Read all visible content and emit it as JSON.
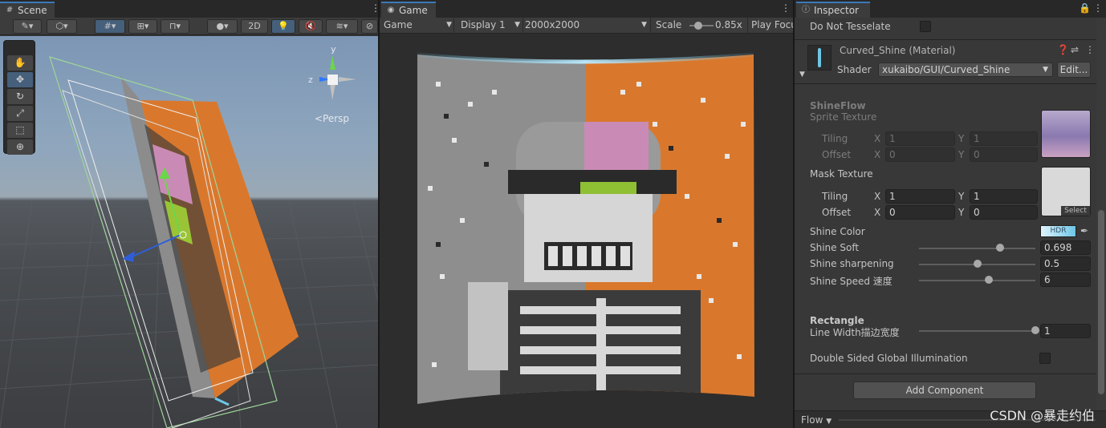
{
  "scene": {
    "tab": "Scene",
    "toolbar": {
      "mode_2d": "2D"
    },
    "persp_label": "<Persp",
    "gizmo": {
      "y": "y",
      "z": "z"
    }
  },
  "game": {
    "tab": "Game",
    "display_mode": "Game",
    "display": "Display 1",
    "resolution": "2000x2000",
    "scale_label": "Scale",
    "scale_value": "0.85x",
    "play_focus": "Play Focu",
    "scale_fraction": 0.3
  },
  "inspector": {
    "tab": "Inspector",
    "do_not_tesselate_label": "Do Not Tesselate",
    "material_name": "Curved_Shine (Material)",
    "shader_label": "Shader",
    "shader_value": "xukaibo/GUI/Curved_Shine",
    "edit_label": "Edit...",
    "shineflow_heading": "ShineFlow",
    "sprite_texture_label": "Sprite Texture",
    "tiling_label": "Tiling",
    "offset_label": "Offset",
    "x_label": "X",
    "y_label": "Y",
    "sprite_tiling_x": "1",
    "sprite_tiling_y": "1",
    "sprite_offset_x": "0",
    "sprite_offset_y": "0",
    "mask_texture_label": "Mask Texture",
    "mask_tiling_x": "1",
    "mask_tiling_y": "1",
    "mask_offset_x": "0",
    "mask_offset_y": "0",
    "select_label": "Select",
    "shine_color_label": "Shine Color",
    "hdr_label": "HDR",
    "shine_soft_label": "Shine Soft",
    "shine_soft_value": "0.698",
    "shine_soft_fraction": 0.698,
    "shine_sharpening_label": "Shine sharpening",
    "shine_sharpening_value": "0.5",
    "shine_sharpening_fraction": 0.5,
    "shine_speed_label": "Shine Speed 速度",
    "shine_speed_value": "6",
    "shine_speed_fraction": 0.6,
    "rectangle_heading": "Rectangle",
    "line_width_label": "Line Width描边宽度",
    "line_width_value": "1",
    "line_width_fraction": 1.0,
    "double_sided_label": "Double Sided Global Illumination",
    "add_component_label": "Add Component",
    "flow_label": "Flow"
  },
  "watermark": "CSDN @暴走约伯",
  "colors": {
    "accent": "#3a79bb",
    "orange": "#d9782d",
    "hdr": "#6ec6e6"
  }
}
